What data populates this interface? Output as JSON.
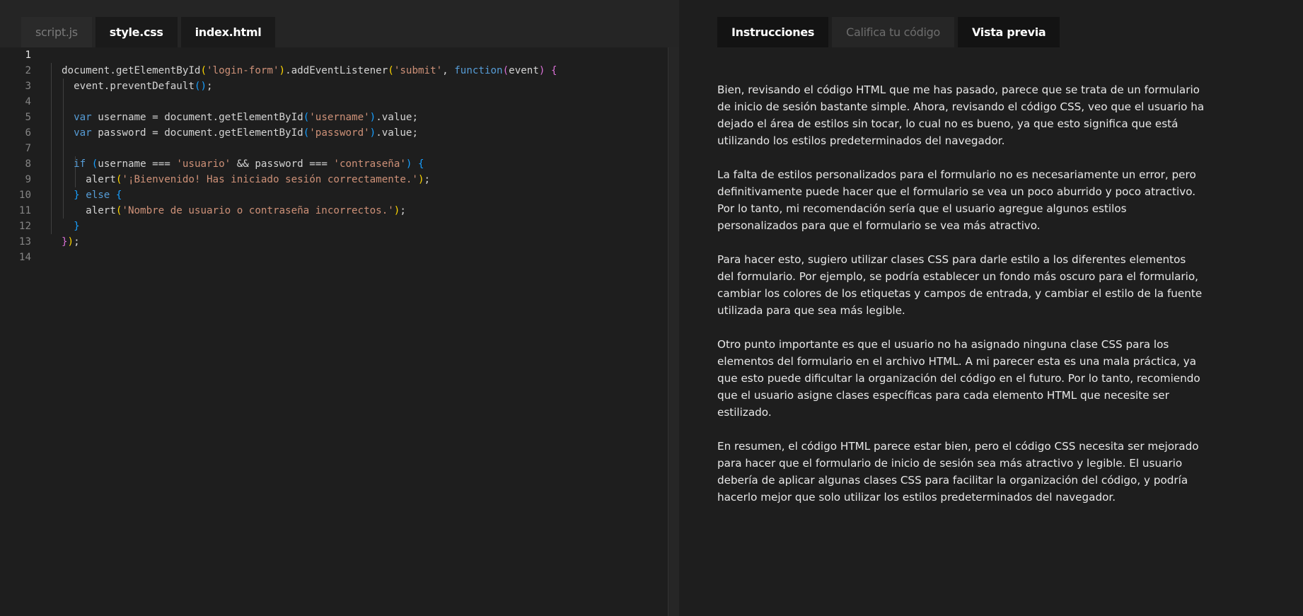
{
  "editor": {
    "tabs": [
      {
        "label": "script.js",
        "active": false
      },
      {
        "label": "style.css",
        "active": true
      },
      {
        "label": "index.html",
        "active": true
      }
    ],
    "line_numbers": [
      "1",
      "2",
      "3",
      "4",
      "5",
      "6",
      "7",
      "8",
      "9",
      "10",
      "11",
      "12",
      "13",
      "14"
    ],
    "code_lines": [
      "",
      "document.getElementById('login-form').addEventListener('submit', function(event) {",
      "  event.preventDefault();",
      "",
      "  var username = document.getElementById('username').value;",
      "  var password = document.getElementById('password').value;",
      "",
      "  if (username === 'usuario' && password === 'contraseña') {",
      "    alert('¡Bienvenido! Has iniciado sesión correctamente.');",
      "  } else {",
      "    alert('Nombre de usuario o contraseña incorrectos.');",
      "  }",
      "});",
      ""
    ]
  },
  "panel": {
    "tabs": [
      {
        "label": "Instrucciones",
        "active": true
      },
      {
        "label": "Califica tu código",
        "active": false
      },
      {
        "label": "Vista previa",
        "active": true
      }
    ],
    "paragraphs": [
      "Bien, revisando el código HTML que me has pasado, parece que se trata de un formulario de inicio de sesión bastante simple. Ahora, revisando el código CSS, veo que el usuario ha dejado el área de estilos sin tocar, lo cual no es bueno, ya que esto significa que está utilizando los estilos predeterminados del navegador.",
      "La falta de estilos personalizados para el formulario no es necesariamente un error, pero definitivamente puede hacer que el formulario se vea un poco aburrido y poco atractivo. Por lo tanto, mi recomendación sería que el usuario agregue algunos estilos personalizados para que el formulario se vea más atractivo.",
      "Para hacer esto, sugiero utilizar clases CSS para darle estilo a los diferentes elementos del formulario. Por ejemplo, se podría establecer un fondo más oscuro para el formulario, cambiar los colores de los etiquetas y campos de entrada, y cambiar el estilo de la fuente utilizada para que sea más legible.",
      "Otro punto importante es que el usuario no ha asignado ninguna clase CSS para los elementos del formulario en el archivo HTML. A mi parecer esta es una mala práctica, ya que esto puede dificultar la organización del código en el futuro. Por lo tanto, recomiendo que el usuario asigne clases específicas para cada elemento HTML que necesite ser estilizado.",
      "En resumen, el código HTML parece estar bien, pero el código CSS necesita ser mejorado para hacer que el formulario de inicio de sesión sea más atractivo y legible. El usuario debería de aplicar algunas clases CSS para facilitar la organización del código, y podría hacerlo mejor que solo utilizar los estilos predeterminados del navegador."
    ]
  },
  "colors": {
    "keyword": "#569cd6",
    "string": "#ce9178",
    "bracket_1": "#ffd700",
    "bracket_2": "#da70d6",
    "bracket_3": "#179fff"
  }
}
